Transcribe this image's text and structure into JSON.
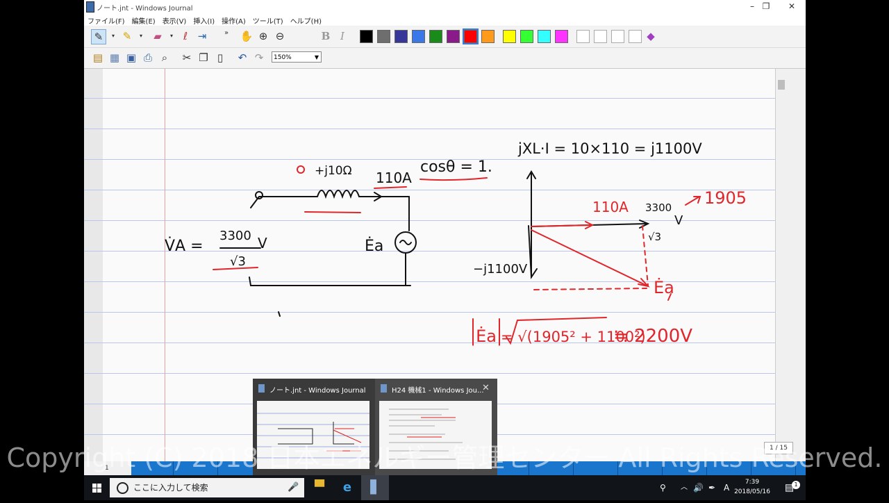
{
  "window": {
    "title": "ノート.jnt - Windows Journal",
    "buttons": {
      "minimize": "–",
      "restore": "❐",
      "close": "✕"
    }
  },
  "menu": [
    "ファイル(F)",
    "編集(E)",
    "表示(V)",
    "挿入(I)",
    "操作(A)",
    "ツール(T)",
    "ヘルプ(H)"
  ],
  "toolbar": {
    "zoom": "150%",
    "bold": "B",
    "italic": "I",
    "pen_colors": [
      "#000000",
      "#6e6e6e",
      "#37379a",
      "#3b78e7",
      "#1a8a1a",
      "#8a1a8a",
      "#ff0000",
      "#ff9a1a",
      "#ffff00",
      "#33ff33",
      "#33ffff",
      "#ff33ff",
      "#ffffff",
      "#ffffff",
      "#ffffff",
      "#ffffff"
    ],
    "selected_color": "#ff0000"
  },
  "note": {
    "page_indicator": "1 / 15",
    "page_tab_label": "1",
    "handwriting": {
      "va_label": "V̇A =",
      "va_numerator": "3300",
      "va_denominator": "√3",
      "va_unit": "V",
      "reactance": "+j10Ω",
      "current_label": "110A",
      "power_factor": "cosθ = 1.",
      "ea_label": "Ėa",
      "jxi_label": "jXL·I = 10×110 = j1100V",
      "current_vector": "110A",
      "va_vector_num": "3300",
      "va_vector_den": "√3",
      "va_vector_unit": "V",
      "va_value": "1905",
      "minus_j": "−j1100V",
      "ea_vector": "Ėa",
      "ea_magnitude_lhs": "|Ėa|",
      "ea_magnitude_expr": "= √(1905² + 1100²)",
      "ea_result": "≒ 2200V"
    }
  },
  "taskbar": {
    "search_placeholder": "ここに入力して検索",
    "tray_ime": "A",
    "clock_time": "7:39",
    "clock_date": "2018/05/16",
    "notification_count": "1"
  },
  "task_previews": [
    {
      "title": "ノート.jnt - Windows Journal"
    },
    {
      "title": "H24 機械1 - Windows Jou..."
    }
  ],
  "watermark": "Copyright (C) 2018 日本エネルギー管理センター All Rights Reserved."
}
